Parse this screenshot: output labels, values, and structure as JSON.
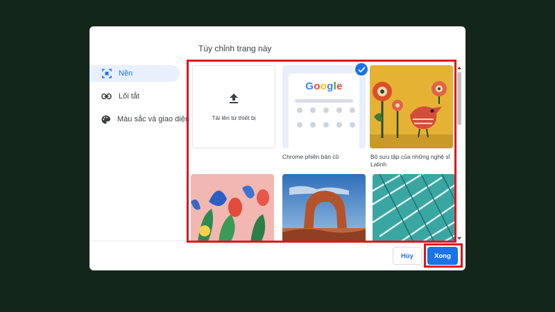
{
  "dialog": {
    "title": "Tùy chỉnh trang này"
  },
  "sidebar": {
    "items": [
      {
        "label": "Nền",
        "icon": "background-icon",
        "active": true
      },
      {
        "label": "Lối tắt",
        "icon": "link-icon",
        "active": false
      },
      {
        "label": "Màu sắc và giao diện",
        "icon": "palette-icon",
        "active": false
      }
    ]
  },
  "tiles": {
    "upload_label": "Tải lên từ thiết bị",
    "chrome_label": "Chrome phiên bản cũ",
    "chrome_logo": "Google",
    "artists_label": "Bộ sưu tập của những nghệ sĩ Latinh"
  },
  "footer": {
    "cancel_label": "Hủy",
    "done_label": "Xong"
  },
  "colors": {
    "accent": "#1a73e8",
    "highlight": "#e1121c",
    "backdrop": "#12261a"
  }
}
